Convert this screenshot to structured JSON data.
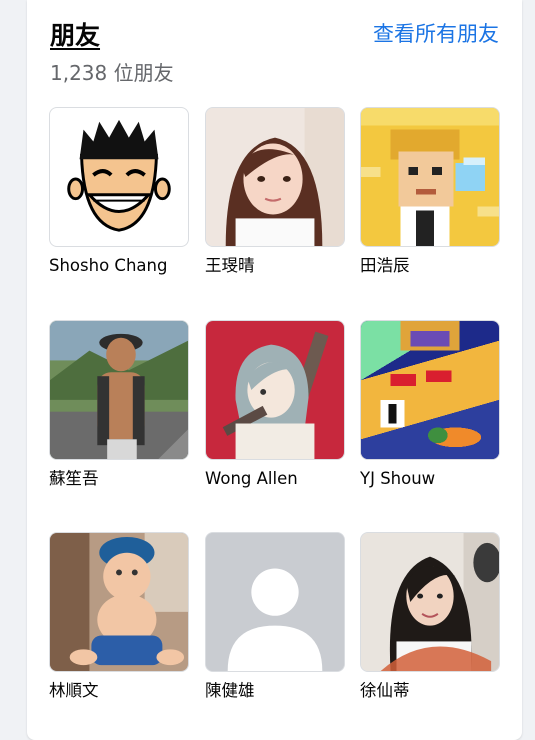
{
  "friends_section": {
    "title": "朋友",
    "count": "1,238 位朋友",
    "see_all": "查看所有朋友"
  },
  "friends": [
    {
      "name": "Shosho Chang",
      "avatar": "cartoon-face-icon"
    },
    {
      "name": "王琝晴",
      "avatar": "woman-photo"
    },
    {
      "name": "田浩辰",
      "avatar": "pixel-art-avatar"
    },
    {
      "name": "蘇笙吾",
      "avatar": "man-outdoor-photo"
    },
    {
      "name": "Wong Allen",
      "avatar": "anime-illustration"
    },
    {
      "name": "YJ Shouw",
      "avatar": "pixel-collage-avatar"
    },
    {
      "name": "林順文",
      "avatar": "baby-photo"
    },
    {
      "name": "陳健雄",
      "avatar": "default-profile-icon"
    },
    {
      "name": "徐仙蒂",
      "avatar": "woman-portrait-photo"
    }
  ],
  "colors": {
    "link_blue": "#1b74e4",
    "secondary_text": "#65676b",
    "primary_text": "#050505",
    "page_background": "#f0f2f5"
  }
}
